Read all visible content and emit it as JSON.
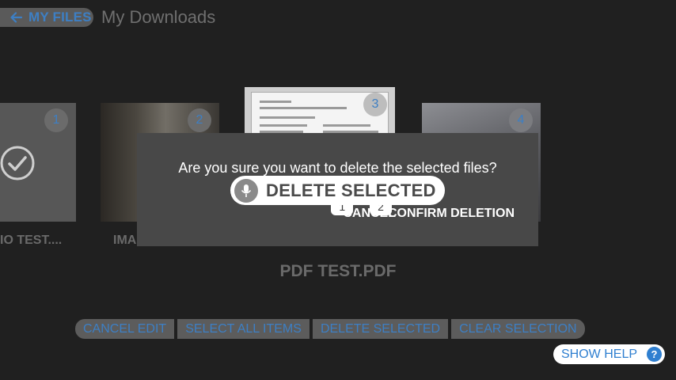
{
  "header": {
    "back_label": "MY FILES",
    "title": "My Downloads"
  },
  "items": [
    {
      "number": "1",
      "label": "IO TEST....",
      "selected": true
    },
    {
      "number": "2",
      "label": "IMA"
    },
    {
      "number": "3"
    },
    {
      "number": "4"
    }
  ],
  "current_item": {
    "name": "PDF TEST.PDF"
  },
  "modal": {
    "question": "Are you sure you want to delete the selected files?",
    "cancel_label": "CANCEL",
    "confirm_label": "CONFIRM DELETION",
    "cancel_hint": "1",
    "confirm_hint": "2"
  },
  "voice": {
    "text": "DELETE SELECTED",
    "icon": "mic-icon"
  },
  "toolbar": {
    "cancel_edit": "CANCEL EDIT",
    "select_all": "SELECT ALL ITEMS",
    "delete_selected": "DELETE SELECTED",
    "clear_selection": "CLEAR SELECTION"
  },
  "help": {
    "label": "SHOW HELP",
    "icon_glyph": "?"
  },
  "colors": {
    "background": "#202020",
    "accent": "#3d7fc4",
    "modal": "#484848"
  }
}
